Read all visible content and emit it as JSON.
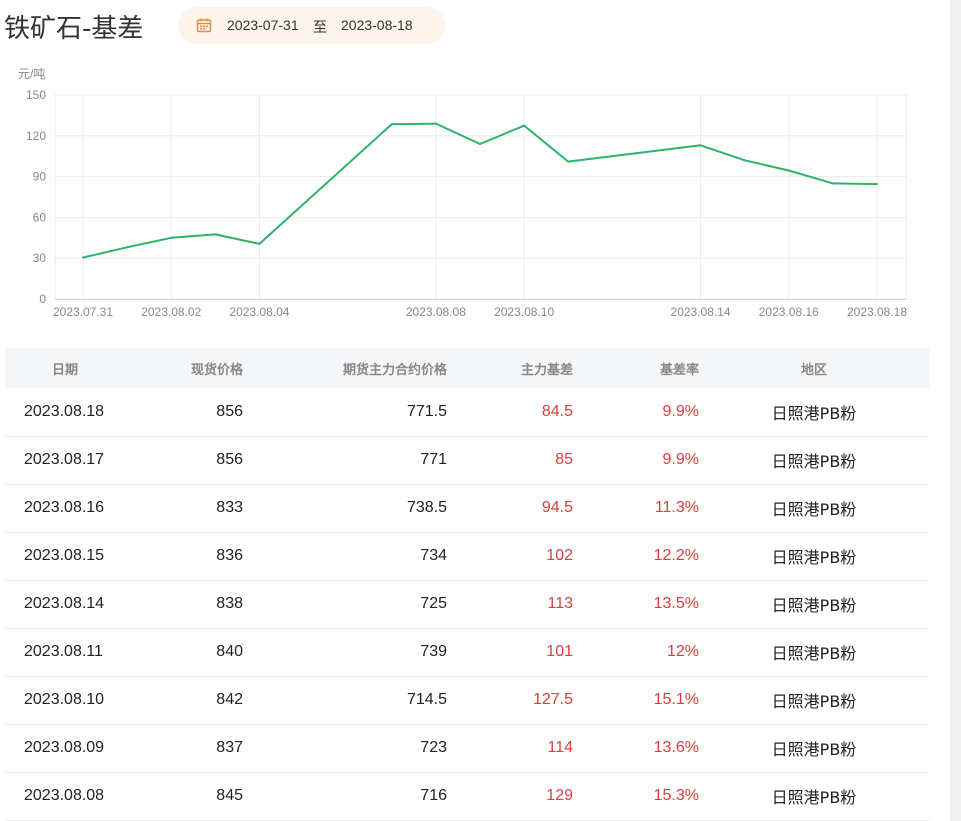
{
  "page": {
    "title": "铁矿石-基差",
    "date_start": "2023-07-31",
    "date_separator": "至",
    "date_end": "2023-08-18"
  },
  "colors": {
    "line": "#2db36b",
    "positive": "#d9403a",
    "date_pill_bg": "#fdf4ec",
    "calendar_icon": "#e0913f"
  },
  "chart_data": {
    "type": "line",
    "ylabel": "元/吨",
    "ylim": [
      0,
      150
    ],
    "yticks": [
      0,
      30,
      60,
      90,
      120,
      150
    ],
    "x": [
      "2023.07.31",
      "2023.08.01",
      "2023.08.02",
      "2023.08.03",
      "2023.08.04",
      "2023.08.07",
      "2023.08.08",
      "2023.08.09",
      "2023.08.10",
      "2023.08.11",
      "2023.08.14",
      "2023.08.15",
      "2023.08.16",
      "2023.08.17",
      "2023.08.18"
    ],
    "xtick_labels": [
      "2023.07.31",
      "2023.08.02",
      "2023.08.04",
      "2023.08.08",
      "2023.08.10",
      "2023.08.14",
      "2023.08.16",
      "2023.08.18"
    ],
    "series": [
      {
        "values": [
          30.5,
          38,
          45,
          47.5,
          40.5,
          128.5,
          129,
          114,
          127.5,
          101,
          113,
          102,
          94.5,
          85,
          84.5
        ]
      }
    ],
    "grid": true
  },
  "table": {
    "headers": [
      "日期",
      "现货价格",
      "期货主力合约价格",
      "主力基差",
      "基差率",
      "地区"
    ],
    "rows": [
      {
        "date": "2023.08.18",
        "spot": "856",
        "futures": "771.5",
        "basis": "84.5",
        "rate": "9.9%",
        "region": "日照港PB粉"
      },
      {
        "date": "2023.08.17",
        "spot": "856",
        "futures": "771",
        "basis": "85",
        "rate": "9.9%",
        "region": "日照港PB粉"
      },
      {
        "date": "2023.08.16",
        "spot": "833",
        "futures": "738.5",
        "basis": "94.5",
        "rate": "11.3%",
        "region": "日照港PB粉"
      },
      {
        "date": "2023.08.15",
        "spot": "836",
        "futures": "734",
        "basis": "102",
        "rate": "12.2%",
        "region": "日照港PB粉"
      },
      {
        "date": "2023.08.14",
        "spot": "838",
        "futures": "725",
        "basis": "113",
        "rate": "13.5%",
        "region": "日照港PB粉"
      },
      {
        "date": "2023.08.11",
        "spot": "840",
        "futures": "739",
        "basis": "101",
        "rate": "12%",
        "region": "日照港PB粉"
      },
      {
        "date": "2023.08.10",
        "spot": "842",
        "futures": "714.5",
        "basis": "127.5",
        "rate": "15.1%",
        "region": "日照港PB粉"
      },
      {
        "date": "2023.08.09",
        "spot": "837",
        "futures": "723",
        "basis": "114",
        "rate": "13.6%",
        "region": "日照港PB粉"
      },
      {
        "date": "2023.08.08",
        "spot": "845",
        "futures": "716",
        "basis": "129",
        "rate": "15.3%",
        "region": "日照港PB粉"
      }
    ]
  }
}
